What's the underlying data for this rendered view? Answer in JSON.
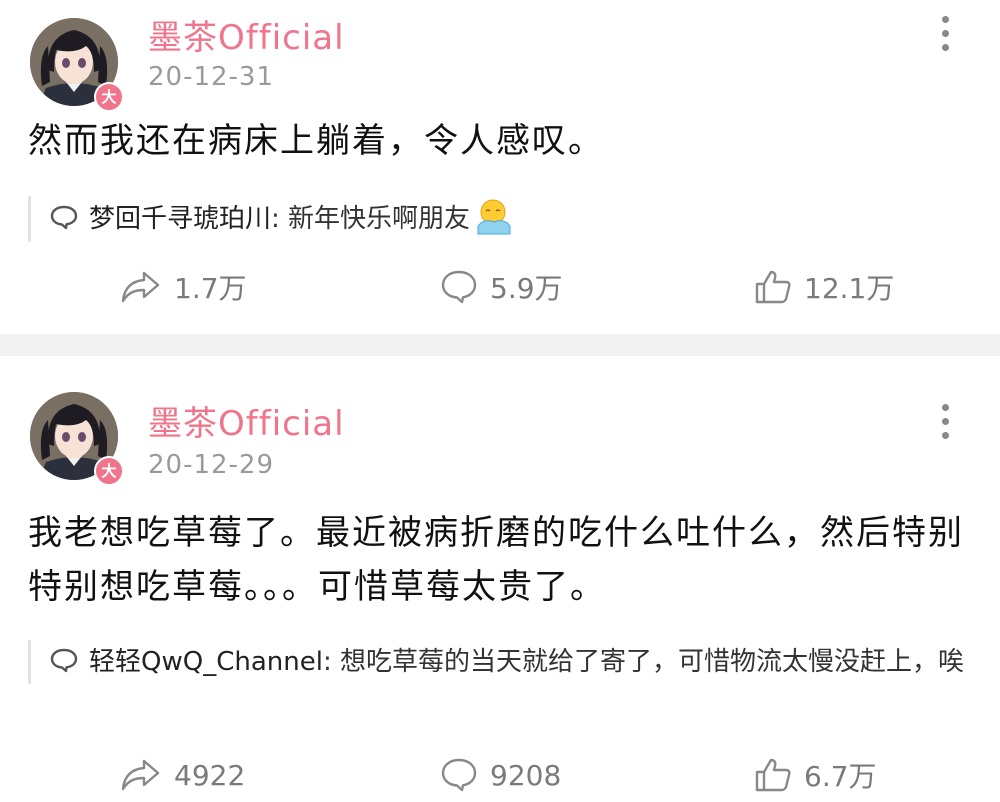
{
  "posts": [
    {
      "author": "墨茶Official",
      "date": "20-12-31",
      "badge": "大",
      "text": "然而我还在病床上躺着，令人感叹。",
      "comment": {
        "name": "梦回千寻琥珀川",
        "sep": ":",
        "text": "新年快乐啊朋友",
        "emoji": "hug-emoji"
      },
      "actions": {
        "share": "1.7万",
        "comment": "5.9万",
        "like": "12.1万"
      }
    },
    {
      "author": "墨茶Official",
      "date": "20-12-29",
      "badge": "大",
      "text": "我老想吃草莓了。最近被病折磨的吃什么吐什么，然后特别特别想吃草莓。。。可惜草莓太贵了。",
      "comment": {
        "name": "轻轻QwQ_Channel",
        "sep": ":",
        "text": "想吃草莓的当天就给了寄了，可惜物流太慢没赶上，唉"
      },
      "actions": {
        "share": "4922",
        "comment": "9208",
        "like": "6.7万"
      }
    }
  ],
  "colors": {
    "author": "#f0758c",
    "badge": "#f0758c",
    "meta": "#9a9a9a",
    "divider": "#f2f2f2"
  }
}
